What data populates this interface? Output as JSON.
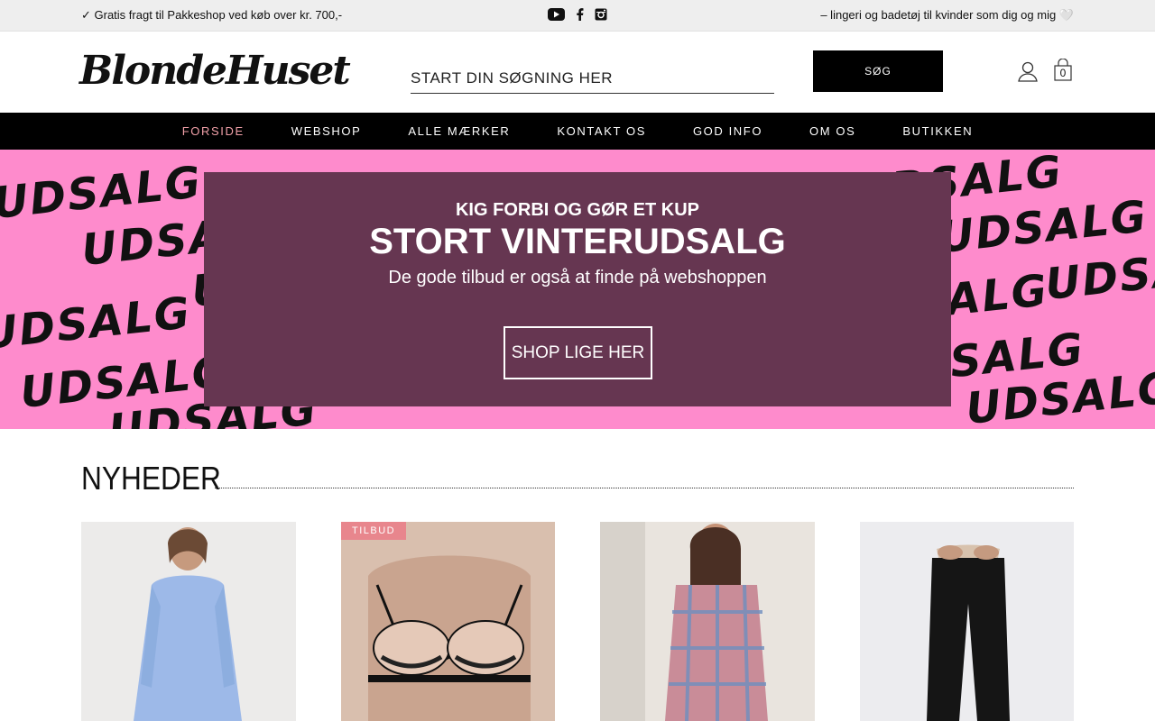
{
  "topbar": {
    "shipping": "✓ Gratis fragt til Pakkeshop ved køb over kr. 700,-",
    "tagline": "– lingeri og badetøj til kvinder som dig og mig 🤍",
    "social": [
      "youtube-icon",
      "facebook-icon",
      "instagram-icon"
    ]
  },
  "header": {
    "logo_text": "BlondeHuset",
    "search_placeholder": "START DIN SØGNING HER",
    "search_button": "SØG",
    "cart_count": "0"
  },
  "nav": {
    "items": [
      {
        "label": "FORSIDE",
        "active": true
      },
      {
        "label": "WEBSHOP",
        "active": false
      },
      {
        "label": "ALLE MÆRKER",
        "active": false
      },
      {
        "label": "KONTAKT OS",
        "active": false
      },
      {
        "label": "GOD INFO",
        "active": false
      },
      {
        "label": "OM OS",
        "active": false
      },
      {
        "label": "BUTIKKEN",
        "active": false
      }
    ]
  },
  "hero": {
    "background_word": "UDSALG",
    "eyebrow": "KIG FORBI OG GØR ET KUP",
    "title": "STORT VINTERUDSALG",
    "subtitle": "De gode tilbud er også at finde på webshoppen",
    "cta": "SHOP LIGE HER",
    "colors": {
      "background": "#fe8bcc",
      "panel": "#663651"
    }
  },
  "section": {
    "title": "NYHEDER"
  },
  "products": [
    {
      "badge": "",
      "image": "blue striped nightdress"
    },
    {
      "badge": "TILBUD",
      "image": "black lace bra"
    },
    {
      "badge": "",
      "image": "plaid pajama shirt"
    },
    {
      "badge": "",
      "image": "black leggings"
    }
  ]
}
